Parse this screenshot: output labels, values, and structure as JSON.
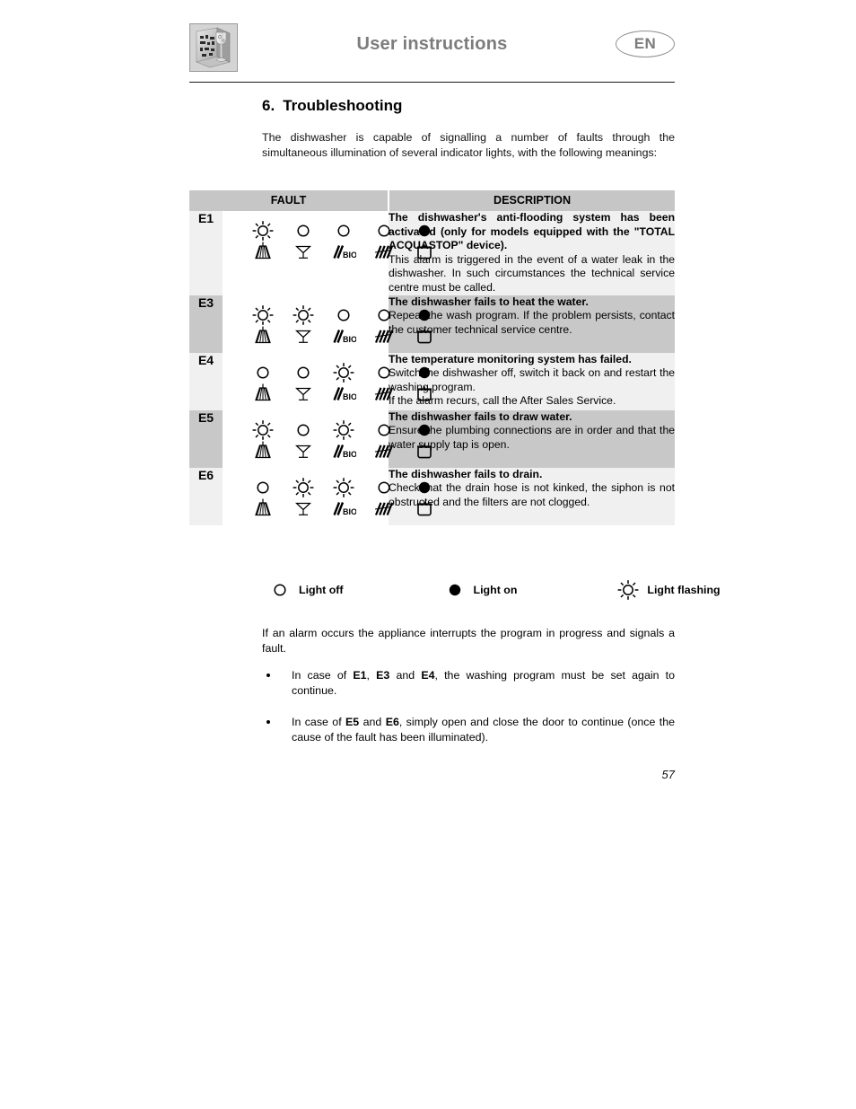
{
  "header": {
    "title": "User instructions",
    "language_badge": "EN",
    "logo_alt": "dishwasher-logo"
  },
  "section": {
    "number": "6.",
    "title": "Troubleshooting"
  },
  "intro": "The dishwasher is capable of signalling a number of faults through the simultaneous illumination of several indicator lights, with the following meanings:",
  "table": {
    "headers": {
      "fault": "FAULT",
      "description": "DESCRIPTION"
    },
    "rows": [
      {
        "code": "E1",
        "shade": "light",
        "lights": [
          "flashing",
          "off",
          "off",
          "off",
          "on"
        ],
        "pictograms": [
          "basket-spray",
          "wine-glass",
          "bio",
          "pasta",
          "pot"
        ],
        "title": "The dishwasher's anti-flooding system has been activated (only for models equipped with the \"TOTAL ACQUASTOP\" device).",
        "body": "This alarm is triggered in the event of a water leak in the dishwasher. In such circumstances the technical service centre must be called."
      },
      {
        "code": "E3",
        "shade": "dark",
        "lights": [
          "flashing",
          "flashing",
          "off",
          "off",
          "on"
        ],
        "pictograms": [
          "basket-spray",
          "wine-glass",
          "bio",
          "pasta",
          "pot"
        ],
        "title": "The dishwasher fails to heat the water.",
        "body": "Repeat the wash program. If the problem persists, contact the customer technical service centre."
      },
      {
        "code": "E4",
        "shade": "light",
        "lights": [
          "off",
          "off",
          "flashing",
          "off",
          "on"
        ],
        "pictograms": [
          "basket-spray",
          "wine-glass",
          "bio",
          "pasta",
          "pot"
        ],
        "title": "The temperature monitoring system has failed.",
        "body": "Switch the dishwasher off, switch it back on and restart the washing program.\nIf the alarm recurs, call the After Sales Service."
      },
      {
        "code": "E5",
        "shade": "dark",
        "lights": [
          "flashing",
          "off",
          "flashing",
          "off",
          "on"
        ],
        "pictograms": [
          "basket-spray",
          "wine-glass",
          "bio",
          "pasta",
          "pot"
        ],
        "title": "The dishwasher fails to draw water.",
        "body": "Ensure the plumbing connections are in order and that the water supply tap is open."
      },
      {
        "code": "E6",
        "shade": "light",
        "lights": [
          "off",
          "flashing",
          "flashing",
          "off",
          "on"
        ],
        "pictograms": [
          "basket-spray",
          "wine-glass",
          "bio",
          "pasta",
          "pot"
        ],
        "title": "The dishwasher fails to drain.",
        "body": "Check that the drain hose is not kinked, the siphon is not obstructed and the filters are not clogged."
      }
    ]
  },
  "legend": [
    {
      "state": "off",
      "label": "Light off"
    },
    {
      "state": "on",
      "label": "Light on"
    },
    {
      "state": "flashing",
      "label": "Light flashing"
    }
  ],
  "after_note": "If an alarm occurs the appliance interrupts the program in progress and signals a fault.",
  "bullets": [
    {
      "parts": [
        {
          "text": "In case of ",
          "bold": false
        },
        {
          "text": "E1",
          "bold": true
        },
        {
          "text": ", ",
          "bold": false
        },
        {
          "text": "E3",
          "bold": true
        },
        {
          "text": " and ",
          "bold": false
        },
        {
          "text": "E4",
          "bold": true
        },
        {
          "text": ", the washing program must be set again to continue.",
          "bold": false
        }
      ]
    },
    {
      "parts": [
        {
          "text": "In case of ",
          "bold": false
        },
        {
          "text": "E5",
          "bold": true
        },
        {
          "text": " and ",
          "bold": false
        },
        {
          "text": "E6",
          "bold": true
        },
        {
          "text": ", simply open and close the door to continue (once the cause of the fault has been illuminated).",
          "bold": false
        }
      ]
    }
  ],
  "page_number": "57",
  "colors": {
    "header_title": "#7c7c7c",
    "table_header_bg": "#c6c6c6",
    "row_light_bg": "#f0f0f0",
    "row_dark_bg": "#c8c8c8",
    "text": "#000000"
  }
}
